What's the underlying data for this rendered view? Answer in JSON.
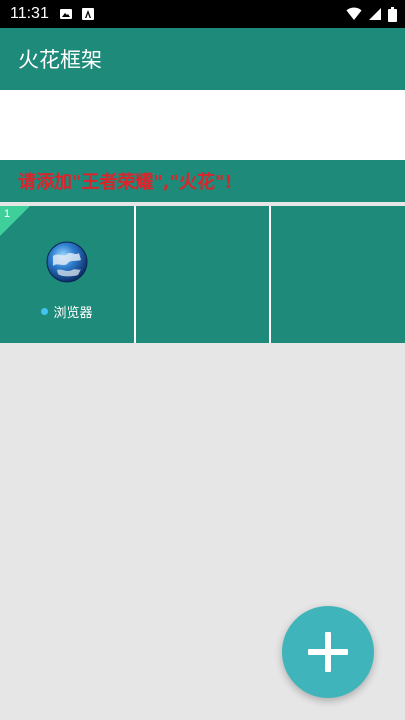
{
  "status_bar": {
    "time": "11:31",
    "left_icons": [
      "image-icon",
      "a-letter-icon"
    ],
    "right_icons": [
      "wifi-icon",
      "signal-icon",
      "battery-icon"
    ]
  },
  "app_bar": {
    "title": "火花框架"
  },
  "hint": {
    "text": "请添加\"王者荣耀\",\"火花\"!"
  },
  "grid": {
    "cells": [
      {
        "badge": "1",
        "icon": "globe-icon",
        "label": "浏览器",
        "status_dot_color": "#45c3f0"
      },
      {},
      {}
    ]
  },
  "fab": {
    "icon": "plus-icon"
  },
  "colors": {
    "primary": "#1e8a7a",
    "hint_text": "#d8262c",
    "fab": "#3fb5bb",
    "background": "#e6e6e6"
  }
}
